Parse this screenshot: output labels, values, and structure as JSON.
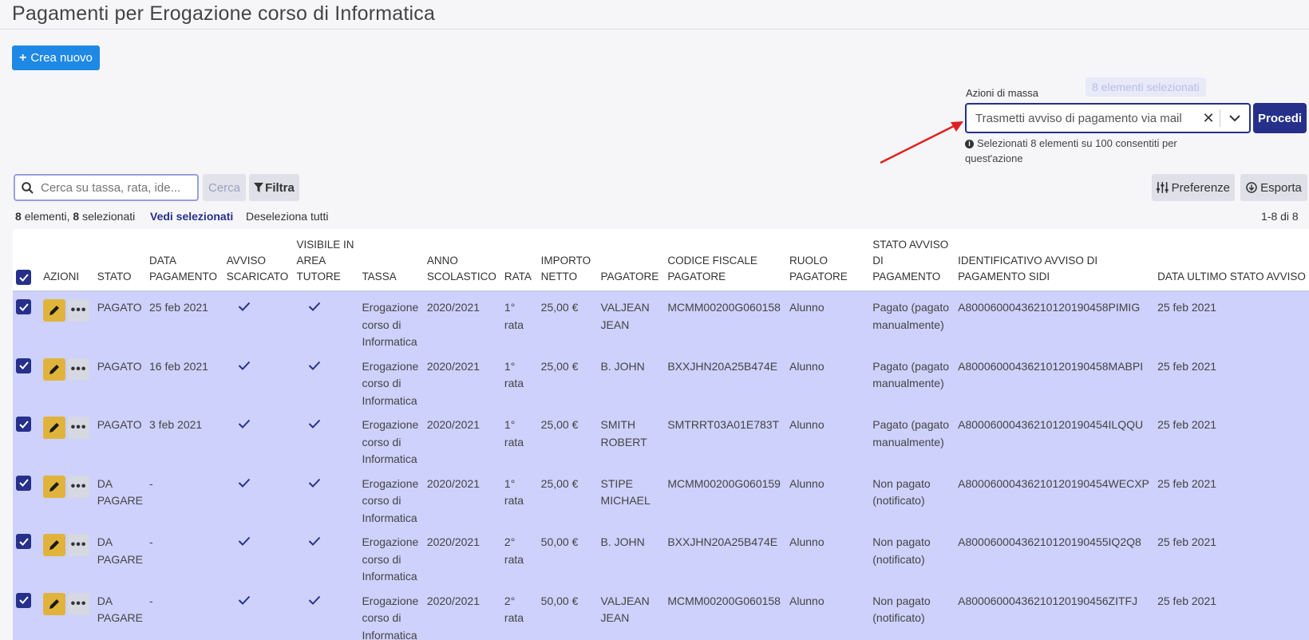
{
  "title": "Pagamenti per Erogazione corso di Informatica",
  "create_button": "Crea nuovo",
  "mass_actions": {
    "label": "Azioni di massa",
    "selected_badge": "8 elementi selezionati",
    "selected_value": "Trasmetti avviso di pagamento via mail",
    "proceed": "Procedi",
    "info": "Selezionati 8 elementi su 100 consentiti per quest'azione"
  },
  "search": {
    "placeholder": "Cerca su tassa, rata, ide...",
    "button": "Cerca",
    "filter": "Filtra"
  },
  "toolbar": {
    "preferences": "Preferenze",
    "export": "Esporta"
  },
  "summary": {
    "count": "8",
    "count_text": "elementi,",
    "selected_count": "8",
    "selected_text": "selezionati",
    "see_selected": "Vedi selezionati",
    "deselect_all": "Deseleziona tutti",
    "pagination": "1-8 di 8"
  },
  "columns": [
    "Azioni",
    "Stato",
    "Data pagamento",
    "Avviso scaricato",
    "Visibile in area tutore",
    "Tassa",
    "Anno scolastico",
    "Rata",
    "Importo netto",
    "Pagatore",
    "Codice fiscale pagatore",
    "Ruolo pagatore",
    "Stato avviso di pagamento",
    "Identificativo avviso di pagamento SIDI",
    "Data ultimo stato avviso"
  ],
  "rows": [
    {
      "stato": "PAGATO",
      "data": "25 feb 2021",
      "tassa": "Erogazione corso di Informatica",
      "anno": "2020/2021",
      "rata": "1° rata",
      "importo": "25,00 €",
      "pagatore": "VALJEAN JEAN",
      "cf": "MCMM00200G060158",
      "ruolo": "Alunno",
      "stato_avviso": "Pagato (pagato manualmente)",
      "id_avviso": "A80006000436210120190458PIMIG",
      "data_ultimo": "25 feb 2021"
    },
    {
      "stato": "PAGATO",
      "data": "16 feb 2021",
      "tassa": "Erogazione corso di Informatica",
      "anno": "2020/2021",
      "rata": "1° rata",
      "importo": "25,00 €",
      "pagatore": "B. JOHN",
      "cf": "BXXJHN20A25B474E",
      "ruolo": "Alunno",
      "stato_avviso": "Pagato (pagato manualmente)",
      "id_avviso": "A80006000436210120190458MABPI",
      "data_ultimo": "25 feb 2021"
    },
    {
      "stato": "PAGATO",
      "data": "3 feb 2021",
      "tassa": "Erogazione corso di Informatica",
      "anno": "2020/2021",
      "rata": "1° rata",
      "importo": "25,00 €",
      "pagatore": "SMITH ROBERT",
      "cf": "SMTRRT03A01E783T",
      "ruolo": "Alunno",
      "stato_avviso": "Pagato (pagato manualmente)",
      "id_avviso": "A80006000436210120190454ILQQU",
      "data_ultimo": "25 feb 2021"
    },
    {
      "stato": "DA PAGARE",
      "data": "-",
      "tassa": "Erogazione corso di Informatica",
      "anno": "2020/2021",
      "rata": "1° rata",
      "importo": "25,00 €",
      "pagatore": "STIPE MICHAEL",
      "cf": "MCMM00200G060159",
      "ruolo": "Alunno",
      "stato_avviso": "Non pagato (notificato)",
      "id_avviso": "A80006000436210120190454WECXP",
      "data_ultimo": "25 feb 2021"
    },
    {
      "stato": "DA PAGARE",
      "data": "-",
      "tassa": "Erogazione corso di Informatica",
      "anno": "2020/2021",
      "rata": "2° rata",
      "importo": "50,00 €",
      "pagatore": "B. JOHN",
      "cf": "BXXJHN20A25B474E",
      "ruolo": "Alunno",
      "stato_avviso": "Non pagato (notificato)",
      "id_avviso": "A80006000436210120190455IQ2Q8",
      "data_ultimo": "25 feb 2021"
    },
    {
      "stato": "DA PAGARE",
      "data": "-",
      "tassa": "Erogazione corso di Informatica",
      "anno": "2020/2021",
      "rata": "2° rata",
      "importo": "50,00 €",
      "pagatore": "VALJEAN JEAN",
      "cf": "MCMM00200G060158",
      "ruolo": "Alunno",
      "stato_avviso": "Non pagato (notificato)",
      "id_avviso": "A80006000436210120190456ZITFJ",
      "data_ultimo": "25 feb 2021"
    }
  ],
  "colors": {
    "primary": "#26308a",
    "accent": "#1e88e5",
    "selected_row": "#cdd1fb",
    "edit": "#e0b43c",
    "annotation_arrow": "#e02020"
  }
}
